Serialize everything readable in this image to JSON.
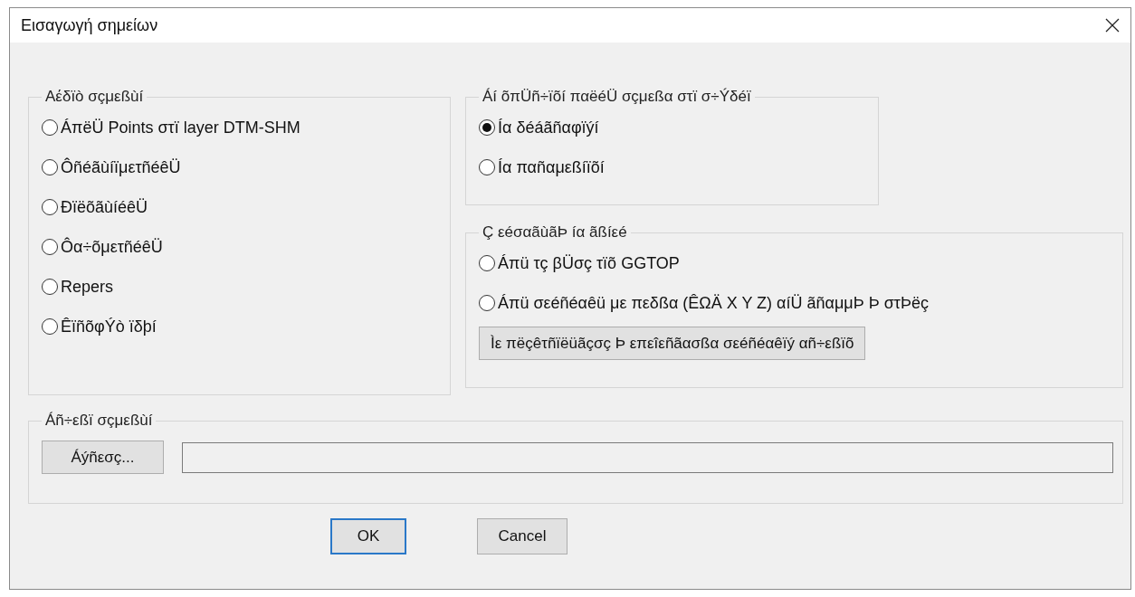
{
  "window": {
    "title": "Εισαγωγή σημείων"
  },
  "point_type": {
    "label": "Αέδïò σçμεßùí",
    "options": [
      {
        "label": "ÁπëÜ Points στï layer DTM-SHM",
        "selected": false
      },
      {
        "label": "ÔñéãùíïμετñéêÜ",
        "selected": false
      },
      {
        "label": "ÐïëõãùíéêÜ",
        "selected": false
      },
      {
        "label": "Ôα÷õμετñéêÜ",
        "selected": false
      },
      {
        "label": "Repers",
        "selected": false
      },
      {
        "label": "ÊïñõφÝò ïδþí",
        "selected": false
      }
    ]
  },
  "existing_points": {
    "label": "Áí õπÜñ÷ïõí παëéÜ σçμεßα στï σ÷Ýδéï",
    "options": [
      {
        "label": "Íα δéáãñαφïýí",
        "selected": true
      },
      {
        "label": "Íα παñαμεßíïõí",
        "selected": false
      }
    ]
  },
  "import_source": {
    "label": "Ç εéσαãùãÞ íα ãßíεé",
    "options": [
      {
        "label": "Áπü τç βÜσç τïõ GGTOP",
        "selected": false
      },
      {
        "label": "Áπü σεéñéαêü με πεδßα (ÊΩÄ X Y Z) αíÜ ãñαμμÞ Þ στÞëç",
        "selected": false
      }
    ],
    "button": "Ìε πëçêτñïëüãçσç Þ επεîεñãασßα σεéñéαêïý αñ÷εßïõ"
  },
  "file": {
    "label": "Áñ÷εßï σçμεßùí",
    "browse_button": "Áýñεσç..."
  },
  "buttons": [
    {
      "label": "OK",
      "default": true
    },
    {
      "label": "Cancel",
      "default": false
    }
  ]
}
